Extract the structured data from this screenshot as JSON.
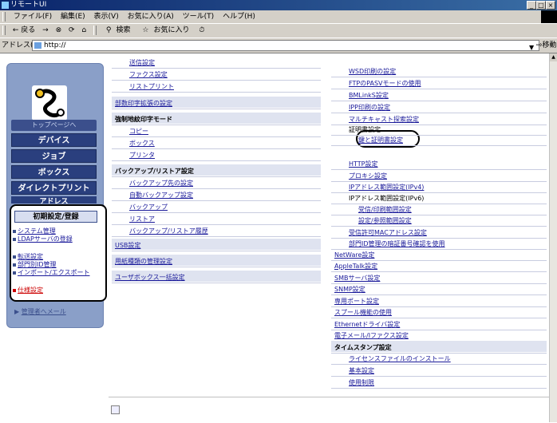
{
  "window": {
    "title": "リモートUI",
    "buttons": [
      "_",
      "□",
      "×"
    ]
  },
  "menubar": [
    "ファイル(F)",
    "編集(E)",
    "表示(V)",
    "お気に入り(A)",
    "ツール(T)",
    "ヘルプ(H)"
  ],
  "toolbar": {
    "back": "← 戻る",
    "forward": "→",
    "search": "検索",
    "favorites": "お気に入り"
  },
  "address": {
    "label": "アドレス(D)",
    "value": "http://",
    "go": "移動"
  },
  "nav": {
    "top": "トップページへ",
    "buttons": [
      "デバイス",
      "ジョブ",
      "ボックス",
      "ダイレクトプリント",
      "アドレス"
    ],
    "submenu_title": "初期設定/登録",
    "submenu": [
      "システム管理",
      "LDAPサーバの登録",
      "転送設定",
      "部門別ID管理",
      "インポート/エクスポート",
      "仕様設定"
    ],
    "admin_mail": "管理者へメール"
  },
  "middle": {
    "items": [
      {
        "text": "送信設定",
        "kind": "link",
        "indent": true
      },
      {
        "text": "ファクス設定",
        "kind": "link",
        "indent": true
      },
      {
        "text": "リストプリント",
        "kind": "link",
        "indent": true
      },
      {
        "text": "部数印字拡張の設定",
        "kind": "link-band"
      },
      {
        "text": "強制地紋印字モード",
        "kind": "label"
      },
      {
        "text": "コピー",
        "kind": "link",
        "indent": true
      },
      {
        "text": "ボックス",
        "kind": "link",
        "indent": true
      },
      {
        "text": "プリンタ",
        "kind": "link",
        "indent": true
      },
      {
        "text": "バックアップ/リストア設定",
        "kind": "label"
      },
      {
        "text": "バックアップ先の設定",
        "kind": "link",
        "indent": true
      },
      {
        "text": "自動バックアップ設定",
        "kind": "link",
        "indent": true
      },
      {
        "text": "バックアップ",
        "kind": "link",
        "indent": true
      },
      {
        "text": "リストア",
        "kind": "link",
        "indent": true
      },
      {
        "text": "バックアップ/リストア履歴",
        "kind": "link",
        "indent": true
      },
      {
        "text": "USB設定",
        "kind": "link-band"
      },
      {
        "text": "用紙種類の管理設定",
        "kind": "link-band"
      },
      {
        "text": "ユーザボックス一括設定",
        "kind": "link-band"
      }
    ]
  },
  "right": {
    "items": [
      {
        "text": "WSD印刷の設定",
        "kind": "link",
        "indent": true
      },
      {
        "text": "FTPのPASVモードの使用",
        "kind": "link",
        "indent": true
      },
      {
        "text": "BMLinkS設定",
        "kind": "link",
        "indent": true
      },
      {
        "text": "IPP印刷の設定",
        "kind": "link",
        "indent": true
      },
      {
        "text": "マルチキャスト探索設定",
        "kind": "link",
        "indent": true
      },
      {
        "text": "証明書設定",
        "kind": "label",
        "indent": true
      },
      {
        "text": "鍵と証明書設定",
        "kind": "link",
        "indent": true,
        "sub": true
      },
      {
        "text": "HTTP設定",
        "kind": "link",
        "indent": true
      },
      {
        "text": "プロキシ設定",
        "kind": "link",
        "indent": true
      },
      {
        "text": "IPアドレス範囲設定(IPv4)",
        "kind": "link",
        "indent": true
      },
      {
        "text": "IPアドレス範囲設定(IPv6)",
        "kind": "label",
        "indent": true
      },
      {
        "text": "受信/印刷範囲設定",
        "kind": "link",
        "indent": true,
        "sub": true
      },
      {
        "text": "設定/参照範囲設定",
        "kind": "link",
        "indent": true,
        "sub": true
      },
      {
        "text": "受信許可MACアドレス設定",
        "kind": "link",
        "indent": true
      },
      {
        "text": "部門ID管理の暗証番号確認を使用",
        "kind": "link",
        "indent": true
      },
      {
        "text": "NetWare設定",
        "kind": "link"
      },
      {
        "text": "AppleTalk設定",
        "kind": "link"
      },
      {
        "text": "SMBサーバ設定",
        "kind": "link"
      },
      {
        "text": "SNMP設定",
        "kind": "link"
      },
      {
        "text": "専用ポート設定",
        "kind": "link"
      },
      {
        "text": "スプール機能の使用",
        "kind": "link"
      },
      {
        "text": "Ethernetドライバ設定",
        "kind": "link"
      },
      {
        "text": "電子メール/Iファクス設定",
        "kind": "link"
      },
      {
        "text": "タイムスタンプ設定",
        "kind": "label"
      },
      {
        "text": "ライセンスファイルのインストール",
        "kind": "link",
        "indent": true
      },
      {
        "text": "基本設定",
        "kind": "link",
        "indent": true
      },
      {
        "text": "使用制限",
        "kind": "link",
        "indent": true
      }
    ]
  }
}
